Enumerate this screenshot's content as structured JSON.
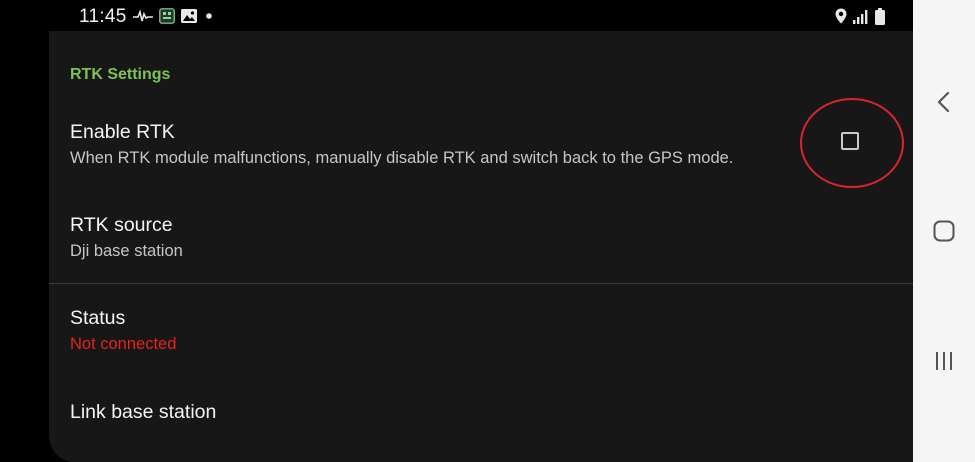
{
  "statusbar": {
    "time": "11:45",
    "icons_left": [
      "activity-icon",
      "app-notification-icon",
      "image-icon",
      "dot-icon"
    ],
    "icons_right": [
      "location-icon",
      "signal-icon",
      "battery-icon"
    ]
  },
  "settings": {
    "section_title": "RTK Settings",
    "enable_rtk": {
      "title": "Enable RTK",
      "summary": "When RTK module malfunctions, manually disable RTK and switch back to the GPS mode.",
      "checked": false
    },
    "rtk_source": {
      "title": "RTK source",
      "summary": "Dji base station"
    },
    "status": {
      "title": "Status",
      "summary": "Not connected"
    },
    "link_base_station": {
      "title": "Link base station"
    }
  },
  "navbar": {
    "buttons": [
      "back-icon",
      "home-icon",
      "recent-apps-icon"
    ]
  },
  "colors": {
    "section_accent": "#7dc353",
    "error": "#e6221c",
    "annotation_circle": "#d9242b",
    "panel_bg": "#171717"
  }
}
